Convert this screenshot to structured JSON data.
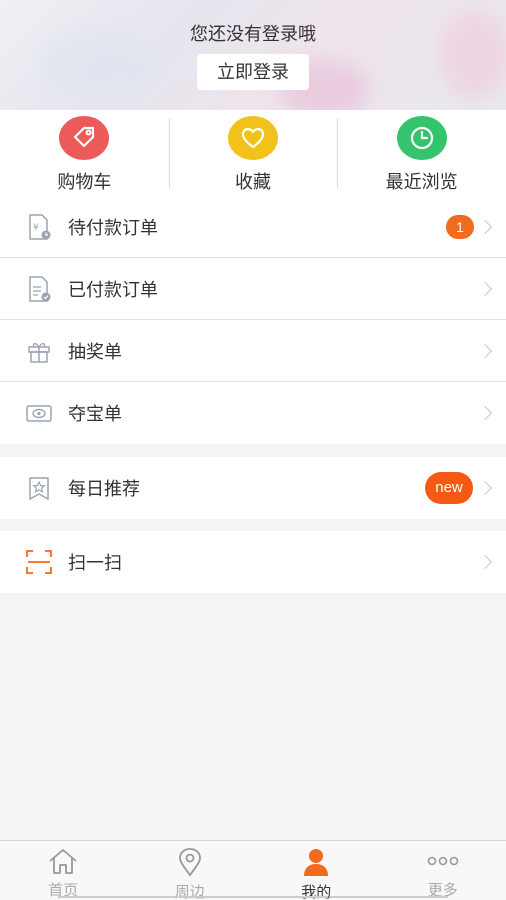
{
  "header": {
    "title": "您还没有登录哦",
    "login_label": "立即登录"
  },
  "quick_links": [
    {
      "label": "购物车",
      "icon": "tag-icon",
      "color": "#ec5a5a"
    },
    {
      "label": "收藏",
      "icon": "heart-icon",
      "color": "#f2c21b"
    },
    {
      "label": "最近浏览",
      "icon": "clock-icon",
      "color": "#33c46d"
    }
  ],
  "orders": [
    {
      "label": "待付款订单",
      "icon": "pending-payment-icon",
      "badge": "1"
    },
    {
      "label": "已付款订单",
      "icon": "paid-order-icon"
    },
    {
      "label": "抽奖单",
      "icon": "gift-icon"
    },
    {
      "label": "夺宝单",
      "icon": "treasure-icon"
    }
  ],
  "recommend": {
    "label": "每日推荐",
    "icon": "star-bookmark-icon",
    "badge": "new"
  },
  "scan": {
    "label": "扫一扫",
    "icon": "scan-icon"
  },
  "tabbar": [
    {
      "label": "首页",
      "icon": "home-icon",
      "active": false
    },
    {
      "label": "周边",
      "icon": "location-icon",
      "active": false
    },
    {
      "label": "我的",
      "icon": "profile-icon",
      "active": true
    },
    {
      "label": "更多",
      "icon": "more-icon",
      "active": false
    }
  ],
  "colors": {
    "accent": "#f26a1b",
    "cart": "#ec5a5a",
    "favorite": "#f2c21b",
    "recent": "#33c46d"
  }
}
